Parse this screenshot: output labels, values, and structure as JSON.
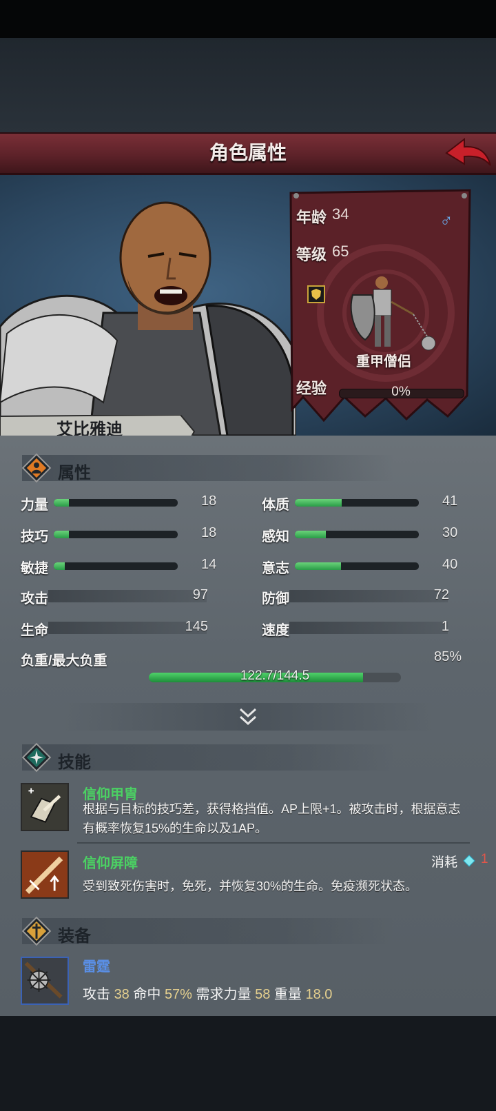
{
  "header": {
    "title": "角色属性"
  },
  "character": {
    "name": "艾比雅迪",
    "age_label": "年龄",
    "age": "34",
    "gender_symbol": "♂",
    "level_label": "等级",
    "level": "65",
    "class_name": "重甲僧侣",
    "exp_label": "经验",
    "exp_text": "0%",
    "exp_fraction": 0
  },
  "attributes": {
    "title": "属性",
    "bars": [
      {
        "label": "力量",
        "value": "18",
        "fill": 0.12
      },
      {
        "label": "体质",
        "value": "41",
        "fill": 0.38
      },
      {
        "label": "技巧",
        "value": "18",
        "fill": 0.12
      },
      {
        "label": "感知",
        "value": "30",
        "fill": 0.25
      },
      {
        "label": "敏捷",
        "value": "14",
        "fill": 0.09
      },
      {
        "label": "意志",
        "value": "40",
        "fill": 0.37
      }
    ],
    "plain": [
      {
        "label": "攻击",
        "value": "97"
      },
      {
        "label": "防御",
        "value": "72"
      },
      {
        "label": "生命",
        "value": "145"
      },
      {
        "label": "速度",
        "value": "1"
      }
    ],
    "load_label": "负重/最大负重",
    "load_text": "122.7/144.5",
    "load_percent": "85%",
    "load_fraction": 0.85
  },
  "skills": {
    "title": "技能",
    "items": [
      {
        "name": "信仰甲胄",
        "desc1": "根据与目标的技巧差，获得格挡值。AP上限+1。被攻击时，根据意志",
        "desc2": "有概率恢复15%的生命以及1AP。"
      },
      {
        "name": "信仰屏障",
        "desc1": "受到致死伤害时，免死，并恢复30%的生命。免疫濒死状态。",
        "cost_label": "消耗",
        "cost_value": "1"
      }
    ]
  },
  "equipment": {
    "title": "装备",
    "item": {
      "name": "雷霆",
      "atk_label": "攻击",
      "atk": "38",
      "hit_label": "命中",
      "hit": "57%",
      "req_label": "需求力量",
      "req": "58",
      "weight_label": "重量",
      "weight": "18.0"
    }
  },
  "colors": {
    "title_bar": "#5d2229",
    "skill_name": "#4bd163",
    "equip_name": "#5a8fe6",
    "bar_fill": "#2a9d48"
  }
}
